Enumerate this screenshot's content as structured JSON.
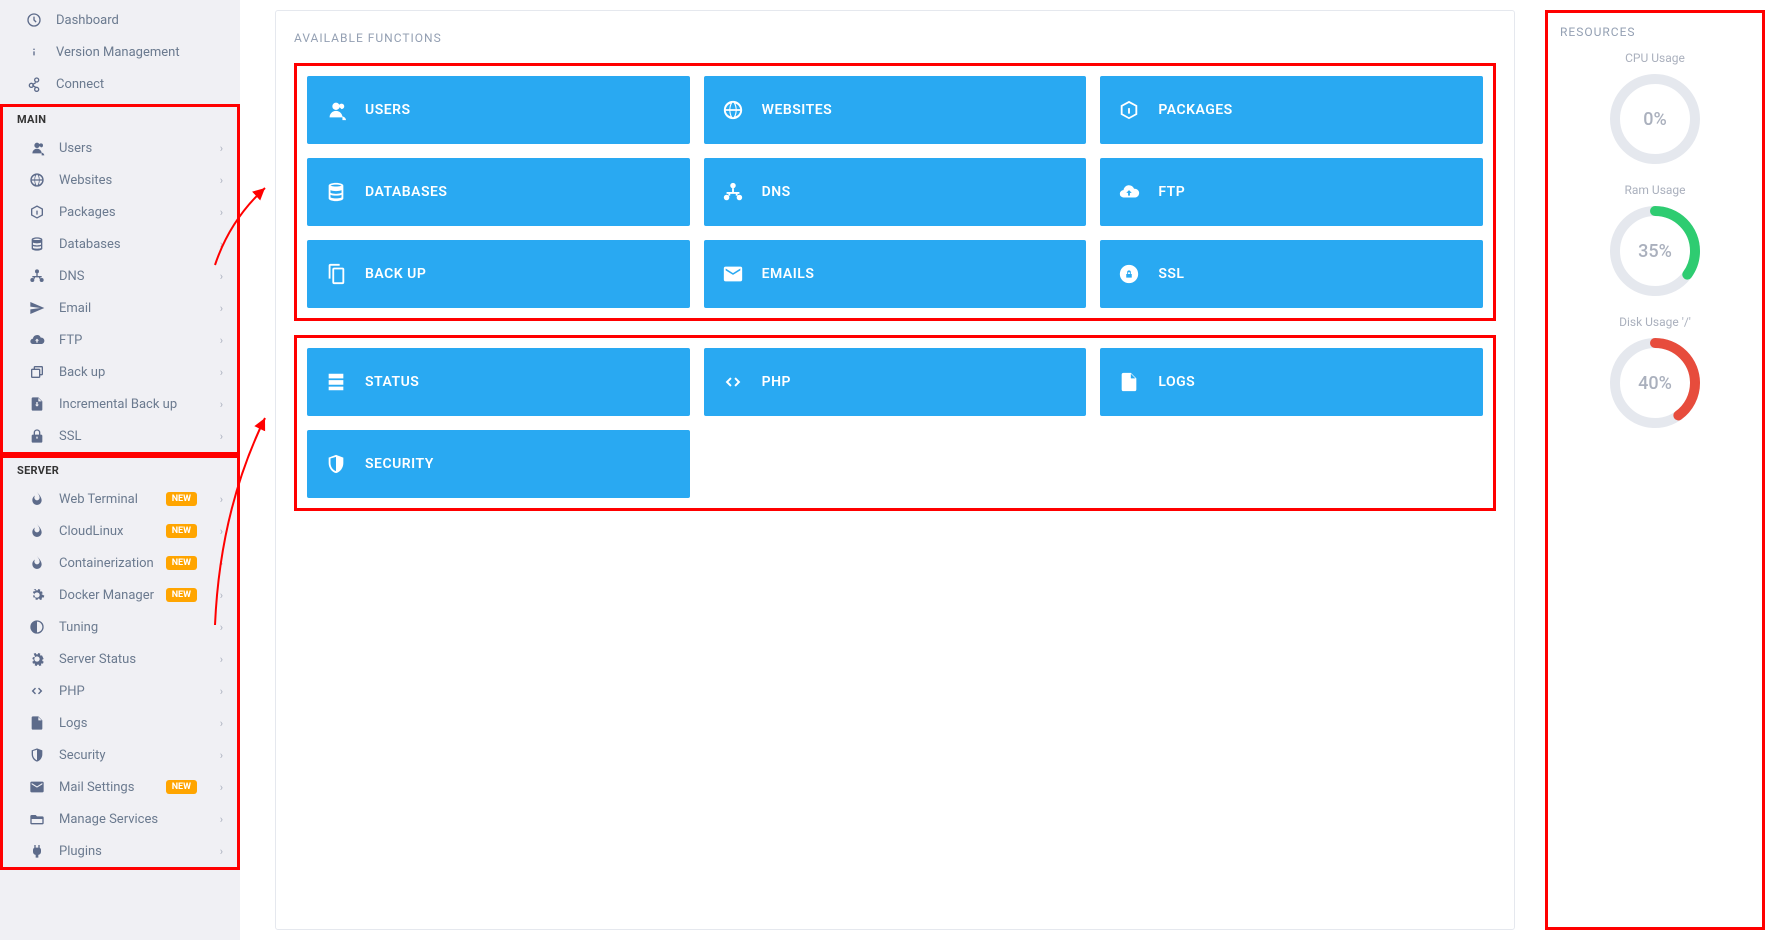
{
  "sidebar": {
    "top": [
      {
        "icon": "dashboard-icon",
        "label": "Dashboard"
      },
      {
        "icon": "info-icon",
        "label": "Version Management"
      },
      {
        "icon": "connect-icon",
        "label": "Connect"
      }
    ],
    "main_header": "MAIN",
    "main": [
      {
        "icon": "users-icon",
        "label": "Users",
        "expand": true
      },
      {
        "icon": "globe-icon",
        "label": "Websites",
        "expand": true
      },
      {
        "icon": "packages-icon",
        "label": "Packages",
        "expand": true
      },
      {
        "icon": "database-icon",
        "label": "Databases",
        "expand": true
      },
      {
        "icon": "dns-icon",
        "label": "DNS",
        "expand": true
      },
      {
        "icon": "send-icon",
        "label": "Email",
        "expand": true
      },
      {
        "icon": "ftp-icon",
        "label": "FTP",
        "expand": true
      },
      {
        "icon": "backup-icon",
        "label": "Back up",
        "expand": true
      },
      {
        "icon": "incremental-backup-icon",
        "label": "Incremental Back up",
        "expand": true
      },
      {
        "icon": "lock-icon",
        "label": "SSL",
        "expand": true
      }
    ],
    "server_header": "SERVER",
    "server": [
      {
        "icon": "fire-icon",
        "label": "Web Terminal",
        "badge": "NEW",
        "expand": true
      },
      {
        "icon": "fire-icon",
        "label": "CloudLinux",
        "badge": "NEW",
        "expand": true
      },
      {
        "icon": "fire-icon",
        "label": "Containerization",
        "badge": "NEW",
        "expand": true
      },
      {
        "icon": "cogs-icon",
        "label": "Docker Manager",
        "badge": "NEW",
        "expand": true
      },
      {
        "icon": "contrast-icon",
        "label": "Tuning",
        "expand": true
      },
      {
        "icon": "cog-icon",
        "label": "Server Status",
        "expand": true
      },
      {
        "icon": "code-icon",
        "label": "PHP",
        "expand": true
      },
      {
        "icon": "file-icon",
        "label": "Logs",
        "expand": true
      },
      {
        "icon": "shield-icon",
        "label": "Security",
        "expand": true
      },
      {
        "icon": "envelope-icon",
        "label": "Mail Settings",
        "badge": "NEW",
        "expand": true
      },
      {
        "icon": "folder-open-icon",
        "label": "Manage Services",
        "expand": true
      },
      {
        "icon": "plug-icon",
        "label": "Plugins",
        "expand": true
      }
    ]
  },
  "functions": {
    "title": "AVAILABLE FUNCTIONS",
    "group1": [
      {
        "icon": "users-icon",
        "label": "USERS"
      },
      {
        "icon": "globe-icon",
        "label": "WEBSITES"
      },
      {
        "icon": "packages-icon",
        "label": "PACKAGES"
      },
      {
        "icon": "database-icon",
        "label": "DATABASES"
      },
      {
        "icon": "dns-icon",
        "label": "DNS"
      },
      {
        "icon": "cloud-up-icon",
        "label": "FTP"
      },
      {
        "icon": "copy-icon",
        "label": "BACK UP"
      },
      {
        "icon": "envelope-icon",
        "label": "EMAILS"
      },
      {
        "icon": "lock-circle-icon",
        "label": "SSL"
      }
    ],
    "group2": [
      {
        "icon": "server-icon",
        "label": "STATUS"
      },
      {
        "icon": "code-icon",
        "label": "PHP"
      },
      {
        "icon": "file-icon",
        "label": "LOGS"
      },
      {
        "icon": "shield-icon",
        "label": "SECURITY"
      }
    ]
  },
  "resources": {
    "title": "RESOURCES",
    "gauges": [
      {
        "label": "CPU Usage",
        "value": 0,
        "display": "0%",
        "color": "#e5e8ee"
      },
      {
        "label": "Ram Usage",
        "value": 35,
        "display": "35%",
        "color": "#2ecc71"
      },
      {
        "label": "Disk Usage '/'",
        "value": 40,
        "display": "40%",
        "color": "#e74c3c"
      }
    ]
  }
}
